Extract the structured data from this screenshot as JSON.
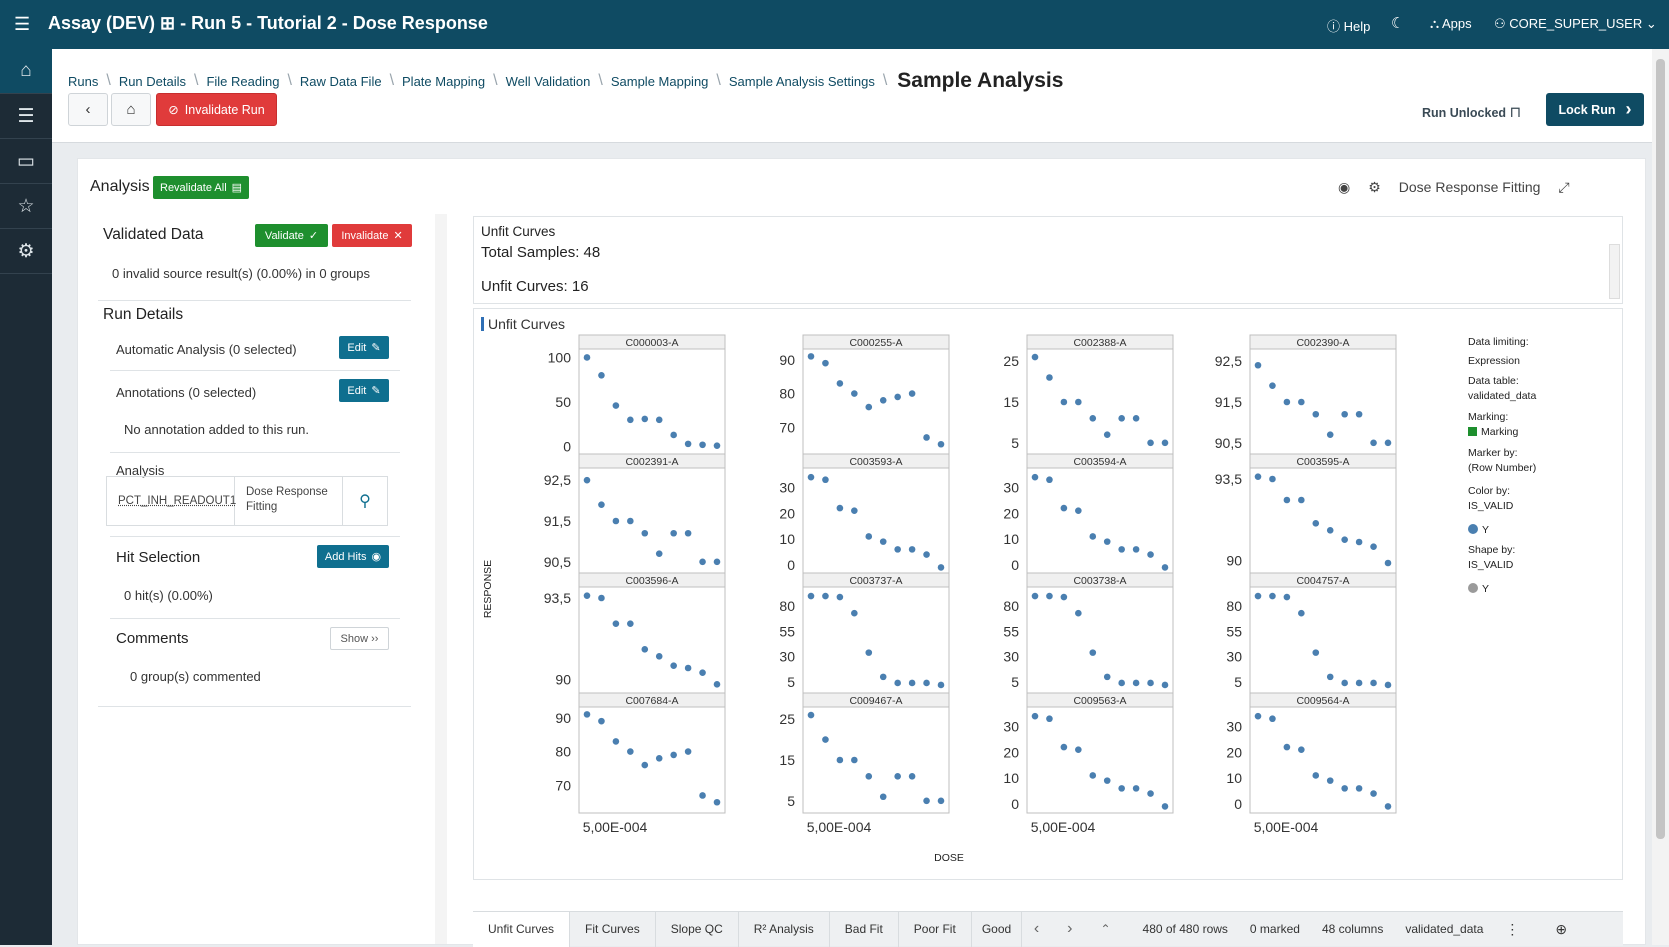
{
  "app": {
    "title": "Assay (DEV) ⊞ - Run 5 - Tutorial 2 - Dose Response",
    "help": "Help",
    "apps": "Apps",
    "user": "CORE_SUPER_USER"
  },
  "breadcrumbs": [
    "Runs",
    "Run Details",
    "File Reading",
    "Raw Data File",
    "Plate Mapping",
    "Well Validation",
    "Sample Mapping",
    "Sample Analysis Settings"
  ],
  "current_page": "Sample Analysis",
  "toolbar": {
    "invalidate_run": "Invalidate Run",
    "run_status": "Run Unlocked",
    "lock_run": "Lock Run"
  },
  "analysis": {
    "title": "Analysis",
    "revalidate_all": "Revalidate All",
    "visualization_name": "Dose Response Fitting"
  },
  "left": {
    "validated_data": "Validated Data",
    "validate": "Validate",
    "invalidate": "Invalidate",
    "invalid_summary": "0 invalid source result(s) (0.00%) in 0 groups",
    "run_details": "Run Details",
    "automatic_analysis": "Automatic Analysis (0 selected)",
    "annotations": "Annotations (0 selected)",
    "edit": "Edit",
    "no_annotation": "No annotation added to this run.",
    "analysis_label": "Analysis",
    "analysis_field": "PCT_INH_READOUT1",
    "analysis_method": "Dose Response Fitting",
    "hit_selection": "Hit Selection",
    "add_hits": "Add Hits",
    "hits_summary": "0 hit(s) (0.00%)",
    "comments": "Comments",
    "show": "Show ››",
    "comments_summary": "0 group(s) commented"
  },
  "summary": {
    "title": "Unfit Curves",
    "total_samples": "Total Samples: 48",
    "unfit_curves": "Unfit Curves: 16"
  },
  "legend": {
    "data_limiting_label": "Data limiting:",
    "data_limiting_value": "Expression",
    "data_table_label": "Data table:",
    "data_table_value": "validated_data",
    "marking_label": "Marking:",
    "marking_value": "Marking",
    "marker_by_label": "Marker by:",
    "marker_by_value": "(Row Number)",
    "color_by_label": "Color by:",
    "color_by_value": "IS_VALID",
    "color_item": "Y",
    "shape_by_label": "Shape by:",
    "shape_by_value": "IS_VALID",
    "shape_item": "Y",
    "marking_color": "#1e8f2e",
    "point_color": "#4a7fb0",
    "shape_color": "#9a9a9a"
  },
  "tabs": [
    "Unfit Curves",
    "Fit Curves",
    "Slope QC",
    "R² Analysis",
    "Bad Fit",
    "Poor Fit",
    "Good"
  ],
  "status": {
    "rows": "480 of 480 rows",
    "marked": "0 marked",
    "columns": "48 columns",
    "table": "validated_data"
  },
  "chart_data": {
    "type": "scatter",
    "title": "Unfit Curves",
    "xlabel": "DOSE",
    "ylabel": "RESPONSE",
    "x_tick_label": "5,00E-004",
    "x": [
      1,
      2,
      3,
      4,
      5,
      6,
      7,
      8,
      9,
      10
    ],
    "panels": [
      {
        "name": "C000003-A",
        "ticks": [
          {
            "v": 100,
            "t": "100"
          },
          {
            "v": 50,
            "t": "50"
          },
          {
            "v": 0,
            "t": "0"
          }
        ],
        "ylim": [
          -5,
          105
        ],
        "values": [
          100,
          80,
          46,
          30,
          31,
          30,
          13,
          3,
          2,
          1
        ]
      },
      {
        "name": "C000255-A",
        "ticks": [
          {
            "v": 90,
            "t": "90"
          },
          {
            "v": 80,
            "t": "80"
          },
          {
            "v": 70,
            "t": "70"
          }
        ],
        "ylim": [
          63,
          92
        ],
        "values": [
          91,
          89,
          83,
          80,
          76,
          78,
          79,
          80,
          67,
          65
        ]
      },
      {
        "name": "C002388-A",
        "ticks": [
          {
            "v": 25,
            "t": "25"
          },
          {
            "v": 15,
            "t": "15"
          },
          {
            "v": 5,
            "t": "5"
          }
        ],
        "ylim": [
          3,
          27
        ],
        "values": [
          26,
          21,
          15,
          15,
          11,
          7,
          11,
          11,
          5,
          5
        ]
      },
      {
        "name": "C002390-A",
        "ticks": [
          {
            "v": 92.5,
            "t": "92,5"
          },
          {
            "v": 91.5,
            "t": "91,5"
          },
          {
            "v": 90.5,
            "t": "90,5"
          }
        ],
        "ylim": [
          90.3,
          92.7
        ],
        "values": [
          92.4,
          91.9,
          91.5,
          91.5,
          91.2,
          90.7,
          91.2,
          91.2,
          90.5,
          90.5
        ]
      },
      {
        "name": "C002391-A",
        "ticks": [
          {
            "v": 92.5,
            "t": "92,5"
          },
          {
            "v": 91.5,
            "t": "91,5"
          },
          {
            "v": 90.5,
            "t": "90,5"
          }
        ],
        "ylim": [
          90.3,
          92.7
        ],
        "values": [
          92.5,
          91.9,
          91.5,
          91.5,
          91.2,
          90.7,
          91.2,
          91.2,
          90.5,
          90.5
        ]
      },
      {
        "name": "C003593-A",
        "ticks": [
          {
            "v": 30,
            "t": "30"
          },
          {
            "v": 20,
            "t": "20"
          },
          {
            "v": 10,
            "t": "10"
          },
          {
            "v": 0,
            "t": "0"
          }
        ],
        "ylim": [
          -2,
          36
        ],
        "values": [
          34,
          33,
          22,
          21,
          11,
          9,
          6,
          6,
          4,
          -1
        ]
      },
      {
        "name": "C003594-A",
        "ticks": [
          {
            "v": 30,
            "t": "30"
          },
          {
            "v": 20,
            "t": "20"
          },
          {
            "v": 10,
            "t": "10"
          },
          {
            "v": 0,
            "t": "0"
          }
        ],
        "ylim": [
          -2,
          36
        ],
        "values": [
          34,
          33,
          22,
          21,
          11,
          9,
          6,
          6,
          4,
          -1
        ]
      },
      {
        "name": "C003595-A",
        "ticks": [
          {
            "v": 93.5,
            "t": "93,5"
          },
          {
            "v": 90,
            "t": "90"
          }
        ],
        "ylim": [
          89.6,
          93.8
        ],
        "values": [
          93.6,
          93.5,
          92.6,
          92.6,
          91.6,
          91.3,
          90.9,
          90.8,
          90.6,
          89.9
        ]
      },
      {
        "name": "C003596-A",
        "ticks": [
          {
            "v": 93.5,
            "t": "93,5"
          },
          {
            "v": 90,
            "t": "90"
          }
        ],
        "ylim": [
          89.6,
          93.8
        ],
        "values": [
          93.6,
          93.5,
          92.4,
          92.4,
          91.3,
          91,
          90.6,
          90.5,
          90.3,
          89.8
        ]
      },
      {
        "name": "C003737-A",
        "ticks": [
          {
            "v": 80,
            "t": "80"
          },
          {
            "v": 55,
            "t": "55"
          },
          {
            "v": 30,
            "t": "30"
          },
          {
            "v": 5,
            "t": "5"
          }
        ],
        "ylim": [
          -2,
          95
        ],
        "values": [
          90,
          90,
          89,
          73,
          34,
          10,
          4,
          4,
          4,
          2
        ]
      },
      {
        "name": "C003738-A",
        "ticks": [
          {
            "v": 80,
            "t": "80"
          },
          {
            "v": 55,
            "t": "55"
          },
          {
            "v": 30,
            "t": "30"
          },
          {
            "v": 5,
            "t": "5"
          }
        ],
        "ylim": [
          -2,
          95
        ],
        "values": [
          90,
          90,
          89,
          73,
          34,
          10,
          4,
          4,
          4,
          2
        ]
      },
      {
        "name": "C004757-A",
        "ticks": [
          {
            "v": 80,
            "t": "80"
          },
          {
            "v": 55,
            "t": "55"
          },
          {
            "v": 30,
            "t": "30"
          },
          {
            "v": 5,
            "t": "5"
          }
        ],
        "ylim": [
          -2,
          95
        ],
        "values": [
          90,
          90,
          89,
          73,
          34,
          10,
          4,
          4,
          4,
          2
        ]
      },
      {
        "name": "C007684-A",
        "ticks": [
          {
            "v": 90,
            "t": "90"
          },
          {
            "v": 80,
            "t": "80"
          },
          {
            "v": 70,
            "t": "70"
          }
        ],
        "ylim": [
          63,
          92
        ],
        "values": [
          91,
          89,
          83,
          80,
          76,
          78,
          79,
          80,
          67,
          65
        ]
      },
      {
        "name": "C009467-A",
        "ticks": [
          {
            "v": 25,
            "t": "25"
          },
          {
            "v": 15,
            "t": "15"
          },
          {
            "v": 5,
            "t": "5"
          }
        ],
        "ylim": [
          3,
          27
        ],
        "values": [
          26,
          20,
          15,
          15,
          11,
          6,
          11,
          11,
          5,
          5
        ]
      },
      {
        "name": "C009563-A",
        "ticks": [
          {
            "v": 30,
            "t": "30"
          },
          {
            "v": 20,
            "t": "20"
          },
          {
            "v": 10,
            "t": "10"
          },
          {
            "v": 0,
            "t": "0"
          }
        ],
        "ylim": [
          -2,
          36
        ],
        "values": [
          34,
          33,
          22,
          21,
          11,
          9,
          6,
          6,
          4,
          -1
        ]
      },
      {
        "name": "C009564-A",
        "ticks": [
          {
            "v": 30,
            "t": "30"
          },
          {
            "v": 20,
            "t": "20"
          },
          {
            "v": 10,
            "t": "10"
          },
          {
            "v": 0,
            "t": "0"
          }
        ],
        "ylim": [
          -2,
          36
        ],
        "values": [
          34,
          33,
          22,
          21,
          11,
          9,
          6,
          6,
          4,
          -1
        ]
      }
    ]
  }
}
